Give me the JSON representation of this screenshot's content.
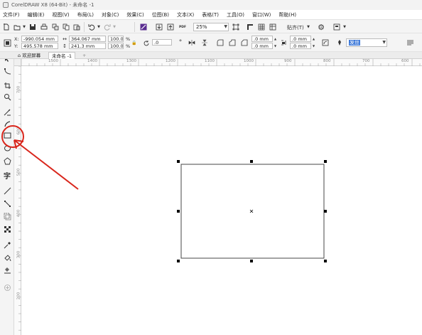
{
  "window": {
    "title": "CorelDRAW X8 (64-Bit) - 未命名 -1"
  },
  "menu": [
    "文件(F)",
    "编辑(E)",
    "视图(V)",
    "布局(L)",
    "对象(C)",
    "效果(C)",
    "位图(B)",
    "文本(X)",
    "表格(T)",
    "工具(O)",
    "窗口(W)",
    "帮助(H)"
  ],
  "toolbar": {
    "zoom_value": "25%",
    "snap_label": "贴齐(T)",
    "pdf_label": "PDF"
  },
  "property_bar": {
    "x_label": "X:",
    "x_value": "-990.054 mm",
    "y_label": "Y:",
    "y_value": "495.578 mm",
    "width_value": "364.067 mm",
    "height_value": "241.3 mm",
    "scale_w": "100.0",
    "scale_h": "100.0",
    "percent": "%",
    "rotation": ".0",
    "corner_1": ".0 mm",
    "corner_2": ".0 mm",
    "corner_3": ".0 mm",
    "corner_4": ".0 mm",
    "outline_value": "发丝"
  },
  "tabs": {
    "welcome": "欢迎屏幕",
    "document": "未命名 -1",
    "add": "+"
  },
  "ruler": {
    "h_ticks": [
      "1500",
      "1400",
      "1300",
      "1200",
      "1100",
      "1000",
      "900",
      "800",
      "700",
      "600"
    ],
    "v_ticks": [
      "700",
      "600",
      "500",
      "400",
      "300",
      "200",
      "100"
    ]
  },
  "toolbox_icons": [
    "pick-tool",
    "shape-tool",
    "crop-tool",
    "zoom-tool",
    "freehand-tool",
    "artistic-media-tool",
    "rectangle-tool",
    "ellipse-tool",
    "polygon-tool",
    "text-tool",
    "parallel-dimension-tool",
    "connector-tool",
    "drop-shadow-tool",
    "transparency-tool",
    "color-eyedropper-tool",
    "interactive-fill-tool",
    "smart-fill-tool",
    "add-tool"
  ],
  "text_tool_glyph": "字",
  "colors": {
    "annotation": "#d9261c",
    "selection_handle": "#000000",
    "toolbar_bg": "#f4f4f4"
  }
}
